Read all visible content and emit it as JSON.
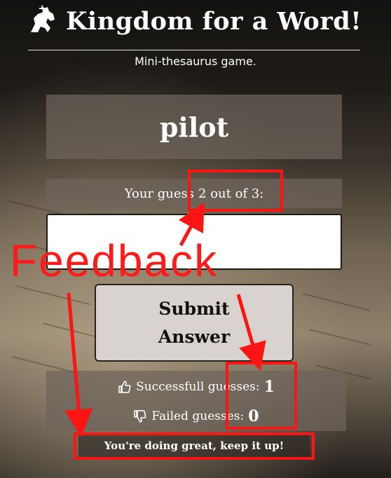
{
  "app": {
    "title": "Kingdom for a Word!",
    "subtitle": "Mini-thesaurus game.",
    "logo_icon": "knight-horse-icon"
  },
  "game": {
    "word": "pilot",
    "guess_prefix": "Your guess",
    "guess_progress": "2 out of 3:",
    "answer_value": ""
  },
  "submit": {
    "line1": "Submit",
    "line2": "Answer"
  },
  "stats": {
    "success_label": "Successfull guesses:",
    "success_count": "1",
    "success_icon": "thumbs-up-icon",
    "failed_label": "Failed guesses:",
    "failed_count": "0",
    "failed_icon": "thumbs-down-icon"
  },
  "feedback_message": "You're doing great, keep it up!",
  "annotation": {
    "label": "Feedback",
    "color": "#ff1414"
  }
}
